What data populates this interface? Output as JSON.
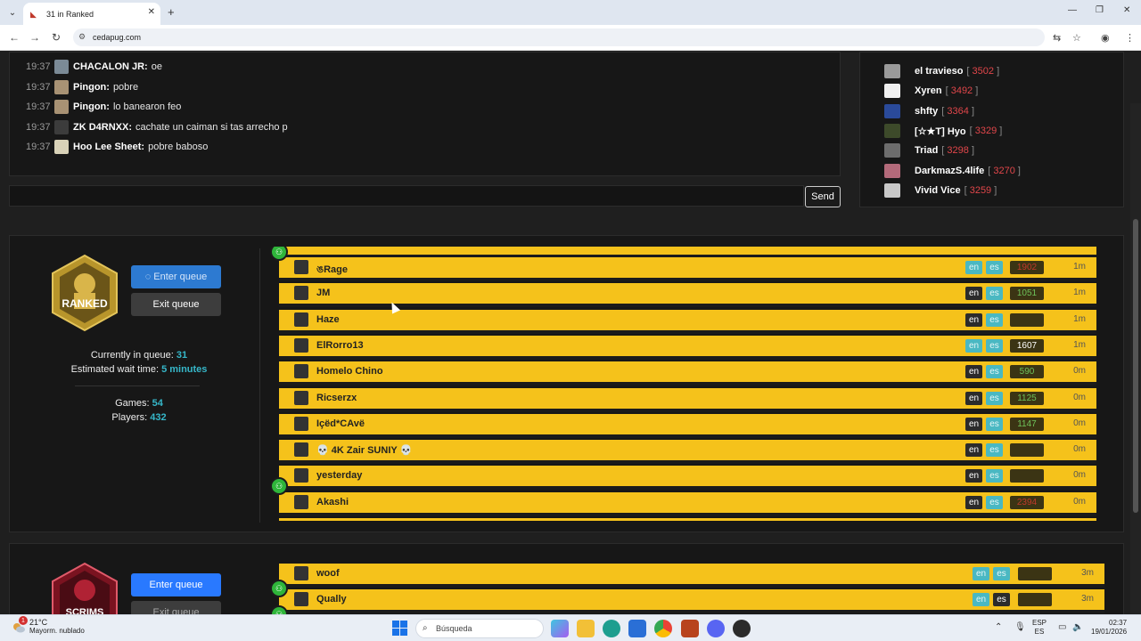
{
  "browser": {
    "tab_title": "31 in Ranked",
    "url": "cedapug.com"
  },
  "chat": {
    "lines": [
      {
        "time": "19:37",
        "user": "CHACALON JR:",
        "msg": "oe"
      },
      {
        "time": "19:37",
        "user": "Pingon:",
        "msg": "pobre"
      },
      {
        "time": "19:37",
        "user": "Pingon:",
        "msg": "lo banearon feo"
      },
      {
        "time": "19:37",
        "user": "ZK D4RNXX:",
        "msg": "cachate un caiman si tas arrecho p"
      },
      {
        "time": "19:37",
        "user": "Hoo Lee Sheet:",
        "msg": "pobre baboso"
      }
    ],
    "send_label": "Send"
  },
  "leaderboard": {
    "items": [
      {
        "name": "el travieso",
        "rating": "3502"
      },
      {
        "name": "Xyren",
        "rating": "3492"
      },
      {
        "name": "shfty",
        "rating": "3364"
      },
      {
        "name": "[☆★T] Hyo",
        "rating": "3329"
      },
      {
        "name": "Triad",
        "rating": "3298"
      },
      {
        "name": "DarkmazS.4life",
        "rating": "3270"
      },
      {
        "name": "Vivid Vice",
        "rating": "3259"
      }
    ]
  },
  "ranked": {
    "badge_text": "RANKED",
    "enter_label": "Enter queue",
    "exit_label": "Exit queue",
    "in_queue_label": "Currently in queue:",
    "in_queue_value": "31",
    "wait_label": "Estimated wait time:",
    "wait_value": "5 minutes",
    "games_label": "Games:",
    "games_value": "54",
    "players_label": "Players:",
    "players_value": "432",
    "rows": [
      {
        "name": "ঙRage",
        "en": false,
        "es": false,
        "rating": "1902",
        "rating_color": "#c0392b",
        "time": "1m",
        "party": true
      },
      {
        "name": "JM",
        "en": true,
        "es": false,
        "rating": "1051",
        "rating_color": "#6ec25a",
        "time": "1m",
        "party": false
      },
      {
        "name": "Haze",
        "en": true,
        "es": false,
        "rating": "",
        "rating_color": "#6ec25a",
        "time": "1m",
        "party": false
      },
      {
        "name": "ElRorro13",
        "en": false,
        "es": false,
        "rating": "1607",
        "rating_color": "#ffffff",
        "time": "1m",
        "party": false
      },
      {
        "name": "Homelo Chino",
        "en": true,
        "es": false,
        "rating": "590",
        "rating_color": "#6ec25a",
        "time": "0m",
        "party": false
      },
      {
        "name": "Ricserzx",
        "en": true,
        "es": false,
        "rating": "1125",
        "rating_color": "#6ec25a",
        "time": "0m",
        "party": false
      },
      {
        "name": "Içëd*CAvë",
        "en": true,
        "es": false,
        "rating": "1147",
        "rating_color": "#6ec25a",
        "time": "0m",
        "party": false
      },
      {
        "name": "💀 4K Zair SUNIY 💀",
        "en": true,
        "es": false,
        "rating": "",
        "rating_color": "#6ec25a",
        "time": "0m",
        "party": false
      },
      {
        "name": "yesterday",
        "en": true,
        "es": false,
        "rating": "",
        "rating_color": "#6ec25a",
        "time": "0m",
        "party": true
      },
      {
        "name": "Akashi",
        "en": true,
        "es": false,
        "rating": "2394",
        "rating_color": "#c0392b",
        "time": "0m",
        "party": false
      }
    ]
  },
  "scrims": {
    "badge_text": "SCRIMS",
    "enter_label": "Enter queue",
    "exit_label": "Exit queue",
    "rows": [
      {
        "name": "woof",
        "en": false,
        "es": false,
        "time": "3m",
        "party": true
      },
      {
        "name": "Qually",
        "en": false,
        "es": true,
        "time": "3m",
        "party": true
      }
    ]
  },
  "taskbar": {
    "temp": "21°C",
    "weather": "Mayorm. nublado",
    "notif_count": "1",
    "search_placeholder": "Búsqueda",
    "lang_top": "ESP",
    "lang_bottom": "ES",
    "time": "02:37",
    "date": "19/01/2026"
  }
}
